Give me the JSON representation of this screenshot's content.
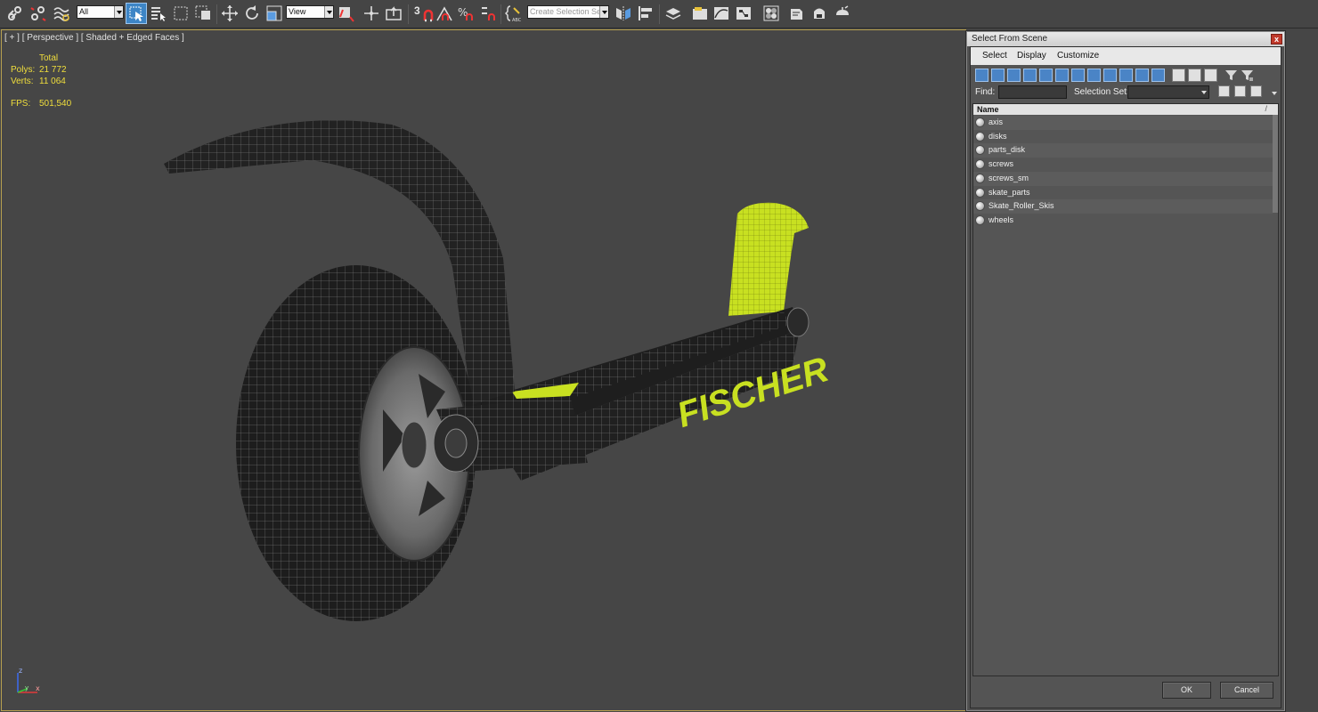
{
  "toolbar": {
    "selection_filter": "All",
    "reference_coordinate_system": "View",
    "snap_label": "3",
    "named_selection_placeholder": "Create Selection Se",
    "icons": [
      "select-and-link",
      "unlink-selection",
      "bind-to-space-warp",
      "select-object",
      "select-by-name",
      "rectangular-selection-region",
      "window-crossing",
      "select-and-move",
      "select-and-rotate",
      "select-and-scale",
      "select-and-manipulate",
      "use-pivot-point-center",
      "snaps-toggle",
      "angle-snap",
      "percent-snap",
      "spinner-snap",
      "edit-named-selection-sets",
      "mirror",
      "align",
      "toggle-layer-explorer",
      "toggle-ribbon",
      "curve-editor",
      "schematic-view",
      "material-editor",
      "render-setup",
      "rendered-frame-window",
      "render-production",
      "render-in-cloud"
    ]
  },
  "viewport": {
    "label": "[ + ] [ Perspective ] [ Shaded + Edged Faces ]",
    "stats": {
      "total_label": "Total",
      "polys_label": "Polys:",
      "polys_value": "21 772",
      "verts_label": "Verts:",
      "verts_value": "11 064",
      "fps_label": "FPS:",
      "fps_value": "501,540"
    },
    "model_brand_text": "FISCHER",
    "axis_labels": {
      "z": "z",
      "x": "x",
      "y": "y"
    },
    "colors": {
      "background": "#464646",
      "frame": "#b7a04f",
      "stats": "#f0de3c",
      "accent_lime": "#c8e021"
    }
  },
  "dialog": {
    "title": "Select From Scene",
    "close_label": "x",
    "menu": [
      "Select",
      "Display",
      "Customize"
    ],
    "find_label": "Find:",
    "find_value": "",
    "selection_set_label": "Selection Set:",
    "selection_set_value": "",
    "list_header": "Name",
    "sort_indicator": "/",
    "objects": [
      "axis",
      "disks",
      "parts_disk",
      "screws",
      "screws_sm",
      "skate_parts",
      "Skate_Roller_Skis",
      "wheels"
    ],
    "ok_label": "OK",
    "cancel_label": "Cancel"
  }
}
